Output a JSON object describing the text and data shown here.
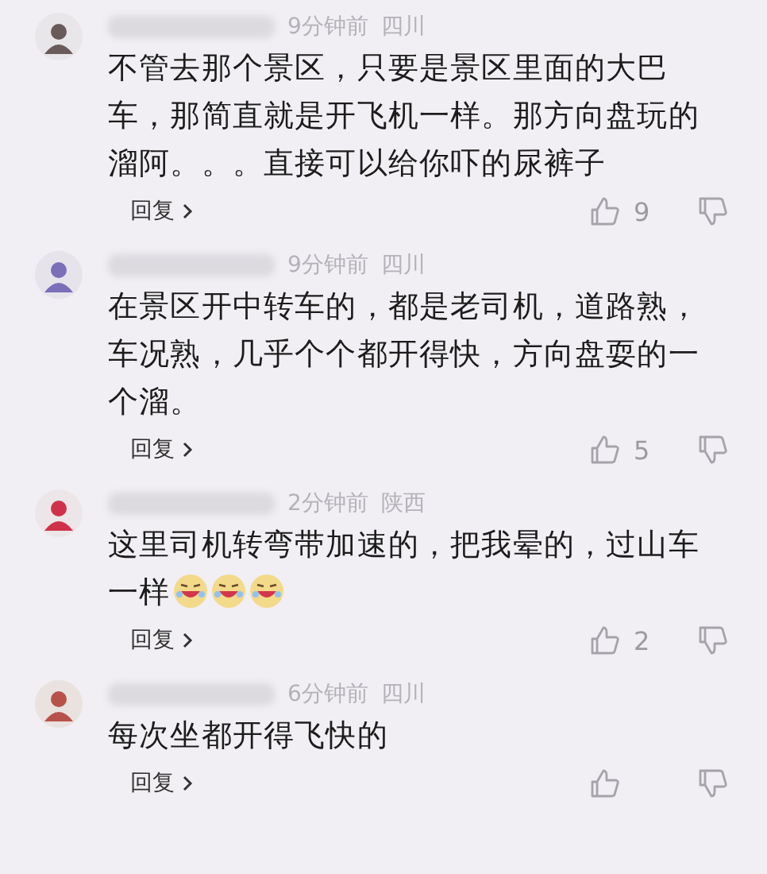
{
  "comments": [
    {
      "time": "9分钟前",
      "region": "四川",
      "text": "不管去那个景区，只要是景区里面的大巴车，那简直就是开飞机一样。那方向盘玩的溜阿。。。直接可以给你吓的尿裤子",
      "reply": "回复",
      "likes": "9"
    },
    {
      "time": "9分钟前",
      "region": "四川",
      "text": "在景区开中转车的，都是老司机，道路熟，车况熟，几乎个个都开得快，方向盘耍的一个溜。",
      "reply": "回复",
      "likes": "5"
    },
    {
      "time": "2分钟前",
      "region": "陕西",
      "text": "这里司机转弯带加速的，把我晕的，过山车一样",
      "emojis": [
        {
          "kind": "laugh-cry"
        },
        {
          "kind": "laugh-cry"
        },
        {
          "kind": "laugh-cry"
        }
      ],
      "reply": "回复",
      "likes": "2"
    },
    {
      "time": "6分钟前",
      "region": "四川",
      "text": "每次坐都开得飞快的",
      "reply": "回复"
    }
  ]
}
